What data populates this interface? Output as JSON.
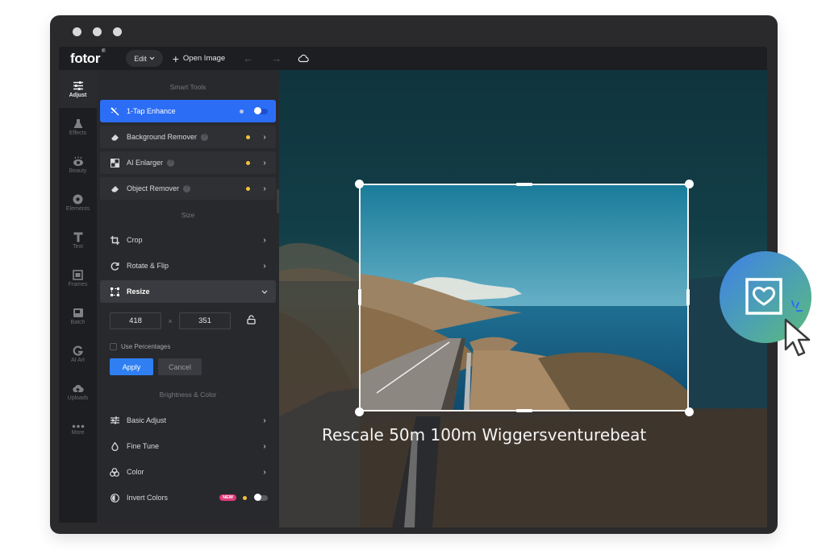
{
  "app": {
    "logo": "fotor",
    "logo_mark": "®"
  },
  "topbar": {
    "edit_label": "Edit",
    "open_image_label": "Open Image",
    "undo_icon": "arrow-left",
    "redo_icon": "arrow-right",
    "cloud_icon": "cloud"
  },
  "rail": {
    "items": [
      {
        "label": "Adjust",
        "icon": "sliders",
        "active": true
      },
      {
        "label": "Effects",
        "icon": "flask"
      },
      {
        "label": "Beauty",
        "icon": "eye"
      },
      {
        "label": "Elements",
        "icon": "circle"
      },
      {
        "label": "Text",
        "icon": "text-T"
      },
      {
        "label": "Frames",
        "icon": "frame"
      },
      {
        "label": "Batch",
        "icon": "images"
      },
      {
        "label": "AI Art",
        "icon": "ai-g"
      },
      {
        "label": "Uploads",
        "icon": "cloud-upload"
      },
      {
        "label": "More",
        "icon": "dots"
      }
    ]
  },
  "panel": {
    "smart_tools_title": "Smart Tools",
    "smart_tools": [
      {
        "label": "1-Tap Enhance",
        "icon": "magic-wand",
        "toggle": "on",
        "active": true
      },
      {
        "label": "Background Remover",
        "icon": "eraser",
        "help": true
      },
      {
        "label": "AI Enlarger",
        "icon": "enlarge",
        "help": true
      },
      {
        "label": "Object Remover",
        "icon": "eraser",
        "help": true
      }
    ],
    "size_title": "Size",
    "size_tools": [
      {
        "label": "Crop",
        "icon": "crop"
      },
      {
        "label": "Rotate & Flip",
        "icon": "rotate"
      },
      {
        "label": "Resize",
        "icon": "resize",
        "expanded": true
      }
    ],
    "resize": {
      "width": "418",
      "height": "351",
      "separator": "×",
      "use_percentages_label": "Use Percentages",
      "use_percentages_checked": false,
      "apply_label": "Apply",
      "cancel_label": "Cancel"
    },
    "brightness_title": "Brightness & Color",
    "brightness_tools": [
      {
        "label": "Basic Adjust",
        "icon": "sliders"
      },
      {
        "label": "Fine Tune",
        "icon": "drop"
      },
      {
        "label": "Color",
        "icon": "color-circles"
      },
      {
        "label": "Invert Colors",
        "icon": "invert",
        "badge": "NEW",
        "toggle": "off"
      }
    ]
  },
  "canvas": {
    "caption": "Rescale 50m 100m Wiggersventurebeat"
  },
  "colors": {
    "accent": "#2c6df5",
    "apply": "#2f7ff2",
    "premium_dot": "#f2c13c",
    "new_badge": "#e23a7a"
  }
}
